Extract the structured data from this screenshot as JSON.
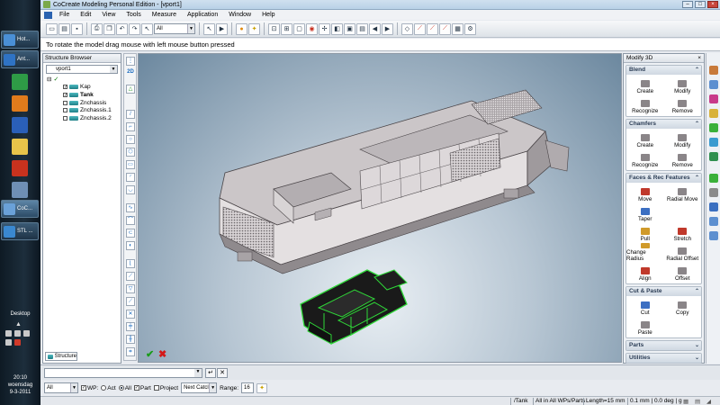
{
  "window": {
    "title": "CoCreate Modeling Personal Edition - [vport1]"
  },
  "taskbar": {
    "tasks": [
      {
        "label": "Hot...",
        "color": "#4a8fd6"
      },
      {
        "label": "Ant...",
        "color": "#2f73c4"
      },
      {
        "label": "CoC...",
        "color": "#6aa1d8"
      },
      {
        "label": "STL ...",
        "color": "#3a88d0"
      }
    ],
    "pinned_colors": [
      "#2e9b46",
      "#e07b1c",
      "#2a5fb8",
      "#e8c44a",
      "#c8321e",
      "#6f8fb5"
    ],
    "desktop_label": "Desktop",
    "clock_time": "20:10",
    "clock_day": "woensdag",
    "clock_date": "9-3-2011"
  },
  "menubar": {
    "items": [
      "File",
      "Edit",
      "View",
      "Tools",
      "Measure",
      "Application",
      "Window",
      "Help"
    ]
  },
  "toolbar": {
    "filter_combo": "All"
  },
  "prompt": {
    "text": "To rotate the model drag mouse with left mouse button pressed"
  },
  "structure_browser": {
    "title": "Structure Browser",
    "viewport_combo": "vport1",
    "items": [
      {
        "label": "Kap",
        "checked": true,
        "bold": false
      },
      {
        "label": "Tank",
        "checked": true,
        "bold": true
      },
      {
        "label": "Znchassis",
        "checked": false,
        "bold": false
      },
      {
        "label": "Znchassis.1",
        "checked": false,
        "bold": false
      },
      {
        "label": "Znchassis.2",
        "checked": false,
        "bold": false
      }
    ],
    "tab_label": "Structure"
  },
  "palette": {
    "label_2d": "2D"
  },
  "modify_panel": {
    "title": "Modify 3D",
    "sections": [
      {
        "title": "Blend",
        "collapsed": false,
        "commands": [
          "Create",
          "Modify",
          "Recognize",
          "Remove"
        ]
      },
      {
        "title": "Chamfers",
        "collapsed": false,
        "commands": [
          "Create",
          "Modify",
          "Recognize",
          "Remove"
        ]
      },
      {
        "title": "Faces & Rec Features",
        "collapsed": false,
        "commands": [
          "Move",
          "Radial Move",
          "Taper",
          "",
          "Pull",
          "Stretch",
          "Change Radius",
          "Radial Offset",
          "Align",
          "Offset"
        ]
      },
      {
        "title": "Cut & Paste",
        "collapsed": false,
        "commands": [
          "Cut",
          "Copy",
          "Paste",
          ""
        ]
      },
      {
        "title": "Parts",
        "collapsed": true,
        "commands": []
      },
      {
        "title": "Utilities",
        "collapsed": true,
        "commands": []
      }
    ]
  },
  "selection_bar": {
    "filter_value": "All",
    "wp_label": "WP:",
    "act_label": "Act",
    "all_label": "All",
    "part_label": "Part",
    "project_label": "Project",
    "catch_value": "Next Catcl",
    "range_label": "Range:",
    "range_value": "16"
  },
  "status_bar": {
    "part": "/Tank",
    "scope": "All in All WPs/Parts",
    "length": "Length=15 mm",
    "units": "0.1 mm | 0.0 deg | g"
  },
  "colors": {
    "accent": "#2a62b0",
    "model_body": "#d9d4d6",
    "chassis": "#2fd838"
  }
}
